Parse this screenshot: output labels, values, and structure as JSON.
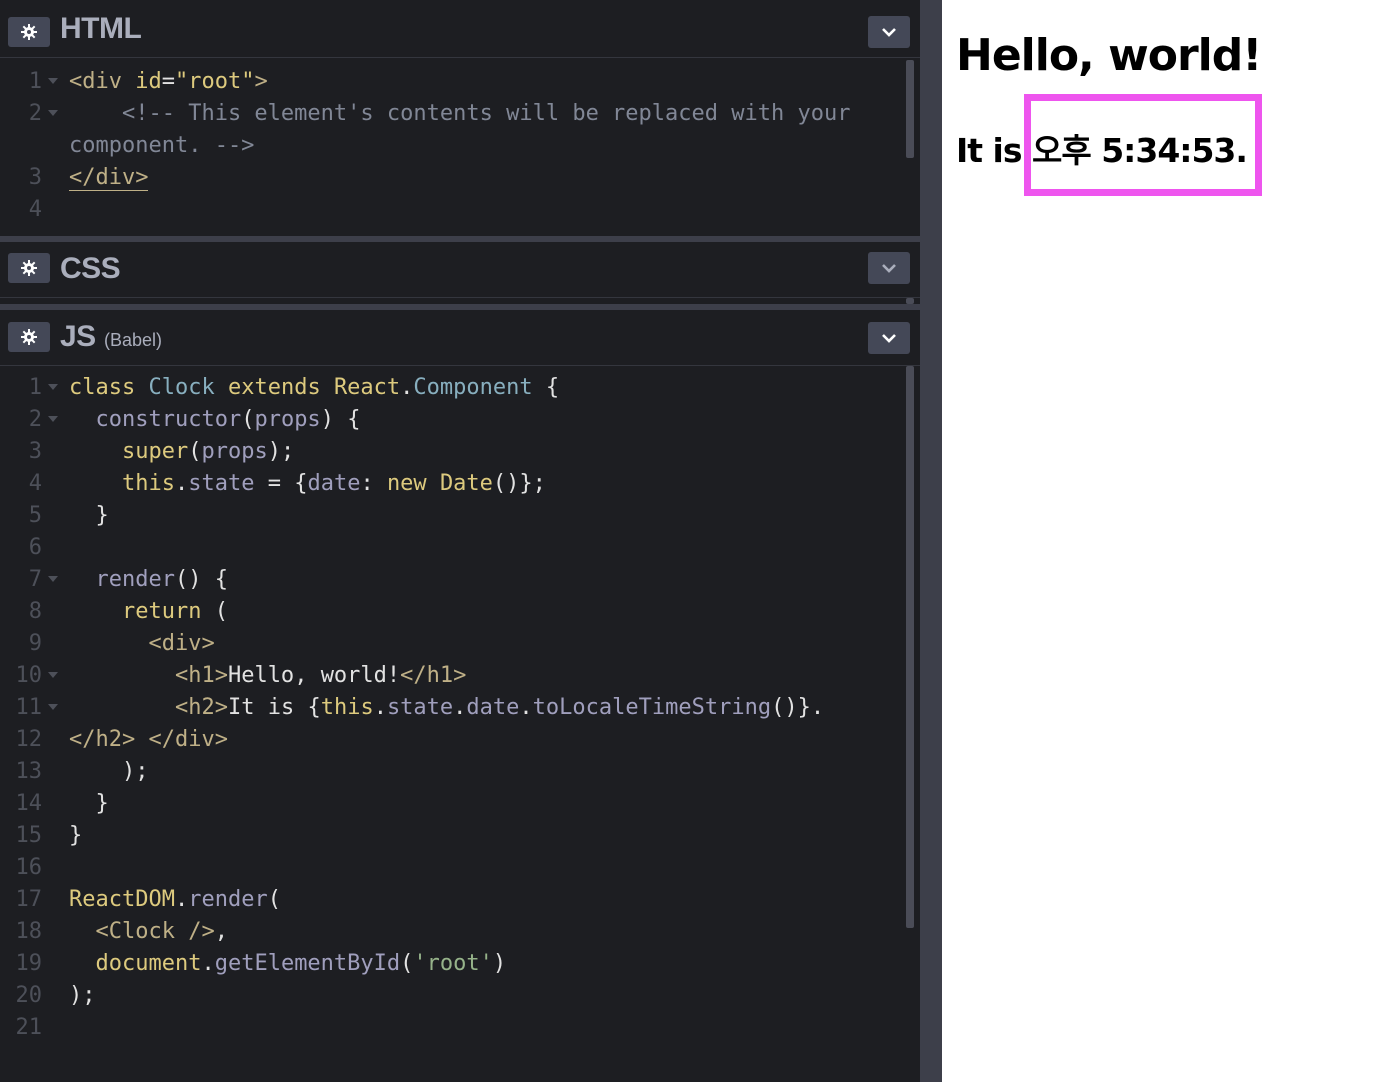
{
  "panels": {
    "html": {
      "title": "HTML"
    },
    "css": {
      "title": "CSS"
    },
    "js": {
      "title": "JS",
      "subtitle": "(Babel)"
    }
  },
  "icons": {
    "settings": "gear-icon",
    "collapse": "chevron-down-icon"
  },
  "html_code": [
    {
      "n": "1",
      "fold": true,
      "text": "<div id=\"root\">"
    },
    {
      "n": "2",
      "fold": true,
      "text": "    <!-- This element's contents will be replaced with your component. -->"
    },
    {
      "n": "3",
      "fold": false,
      "text": "</div>"
    },
    {
      "n": "4",
      "fold": false,
      "text": ""
    }
  ],
  "js_code": [
    {
      "n": "1",
      "fold": true,
      "text": "class Clock extends React.Component {"
    },
    {
      "n": "2",
      "fold": true,
      "text": "  constructor(props) {"
    },
    {
      "n": "3",
      "fold": false,
      "text": "    super(props);"
    },
    {
      "n": "4",
      "fold": false,
      "text": "    this.state = {date: new Date()};"
    },
    {
      "n": "5",
      "fold": false,
      "text": "  }"
    },
    {
      "n": "6",
      "fold": false,
      "text": ""
    },
    {
      "n": "7",
      "fold": true,
      "text": "  render() {"
    },
    {
      "n": "8",
      "fold": false,
      "text": "    return ("
    },
    {
      "n": "9",
      "fold": false,
      "text": "      <div>"
    },
    {
      "n": "10",
      "fold": true,
      "text": "        <h1>Hello, world!</h1>"
    },
    {
      "n": "11",
      "fold": true,
      "text": "        <h2>It is {this.state.date.toLocaleTimeString()}.</h2>"
    },
    {
      "n": "12",
      "fold": false,
      "text": "      </div>"
    },
    {
      "n": "13",
      "fold": false,
      "text": "    );"
    },
    {
      "n": "14",
      "fold": false,
      "text": "  }"
    },
    {
      "n": "15",
      "fold": false,
      "text": "}"
    },
    {
      "n": "16",
      "fold": false,
      "text": ""
    },
    {
      "n": "17",
      "fold": false,
      "text": "ReactDOM.render("
    },
    {
      "n": "18",
      "fold": false,
      "text": "  <Clock />,"
    },
    {
      "n": "19",
      "fold": false,
      "text": "  document.getElementById('root')"
    },
    {
      "n": "20",
      "fold": false,
      "text": ");"
    },
    {
      "n": "21",
      "fold": false,
      "text": ""
    }
  ],
  "preview": {
    "heading": "Hello, world!",
    "time_prefix": "It is ",
    "time_value": "오후 5:34:53.",
    "highlight_color": "#ee55ee"
  },
  "colors": {
    "editor_bg": "#1d1e22",
    "button_bg": "#444857",
    "keyword": "#ddca7e",
    "class_name": "#88afbf",
    "property": "#a09fbd",
    "tag": "#bfb087",
    "string": "#96b38a",
    "comment": "#818796"
  }
}
